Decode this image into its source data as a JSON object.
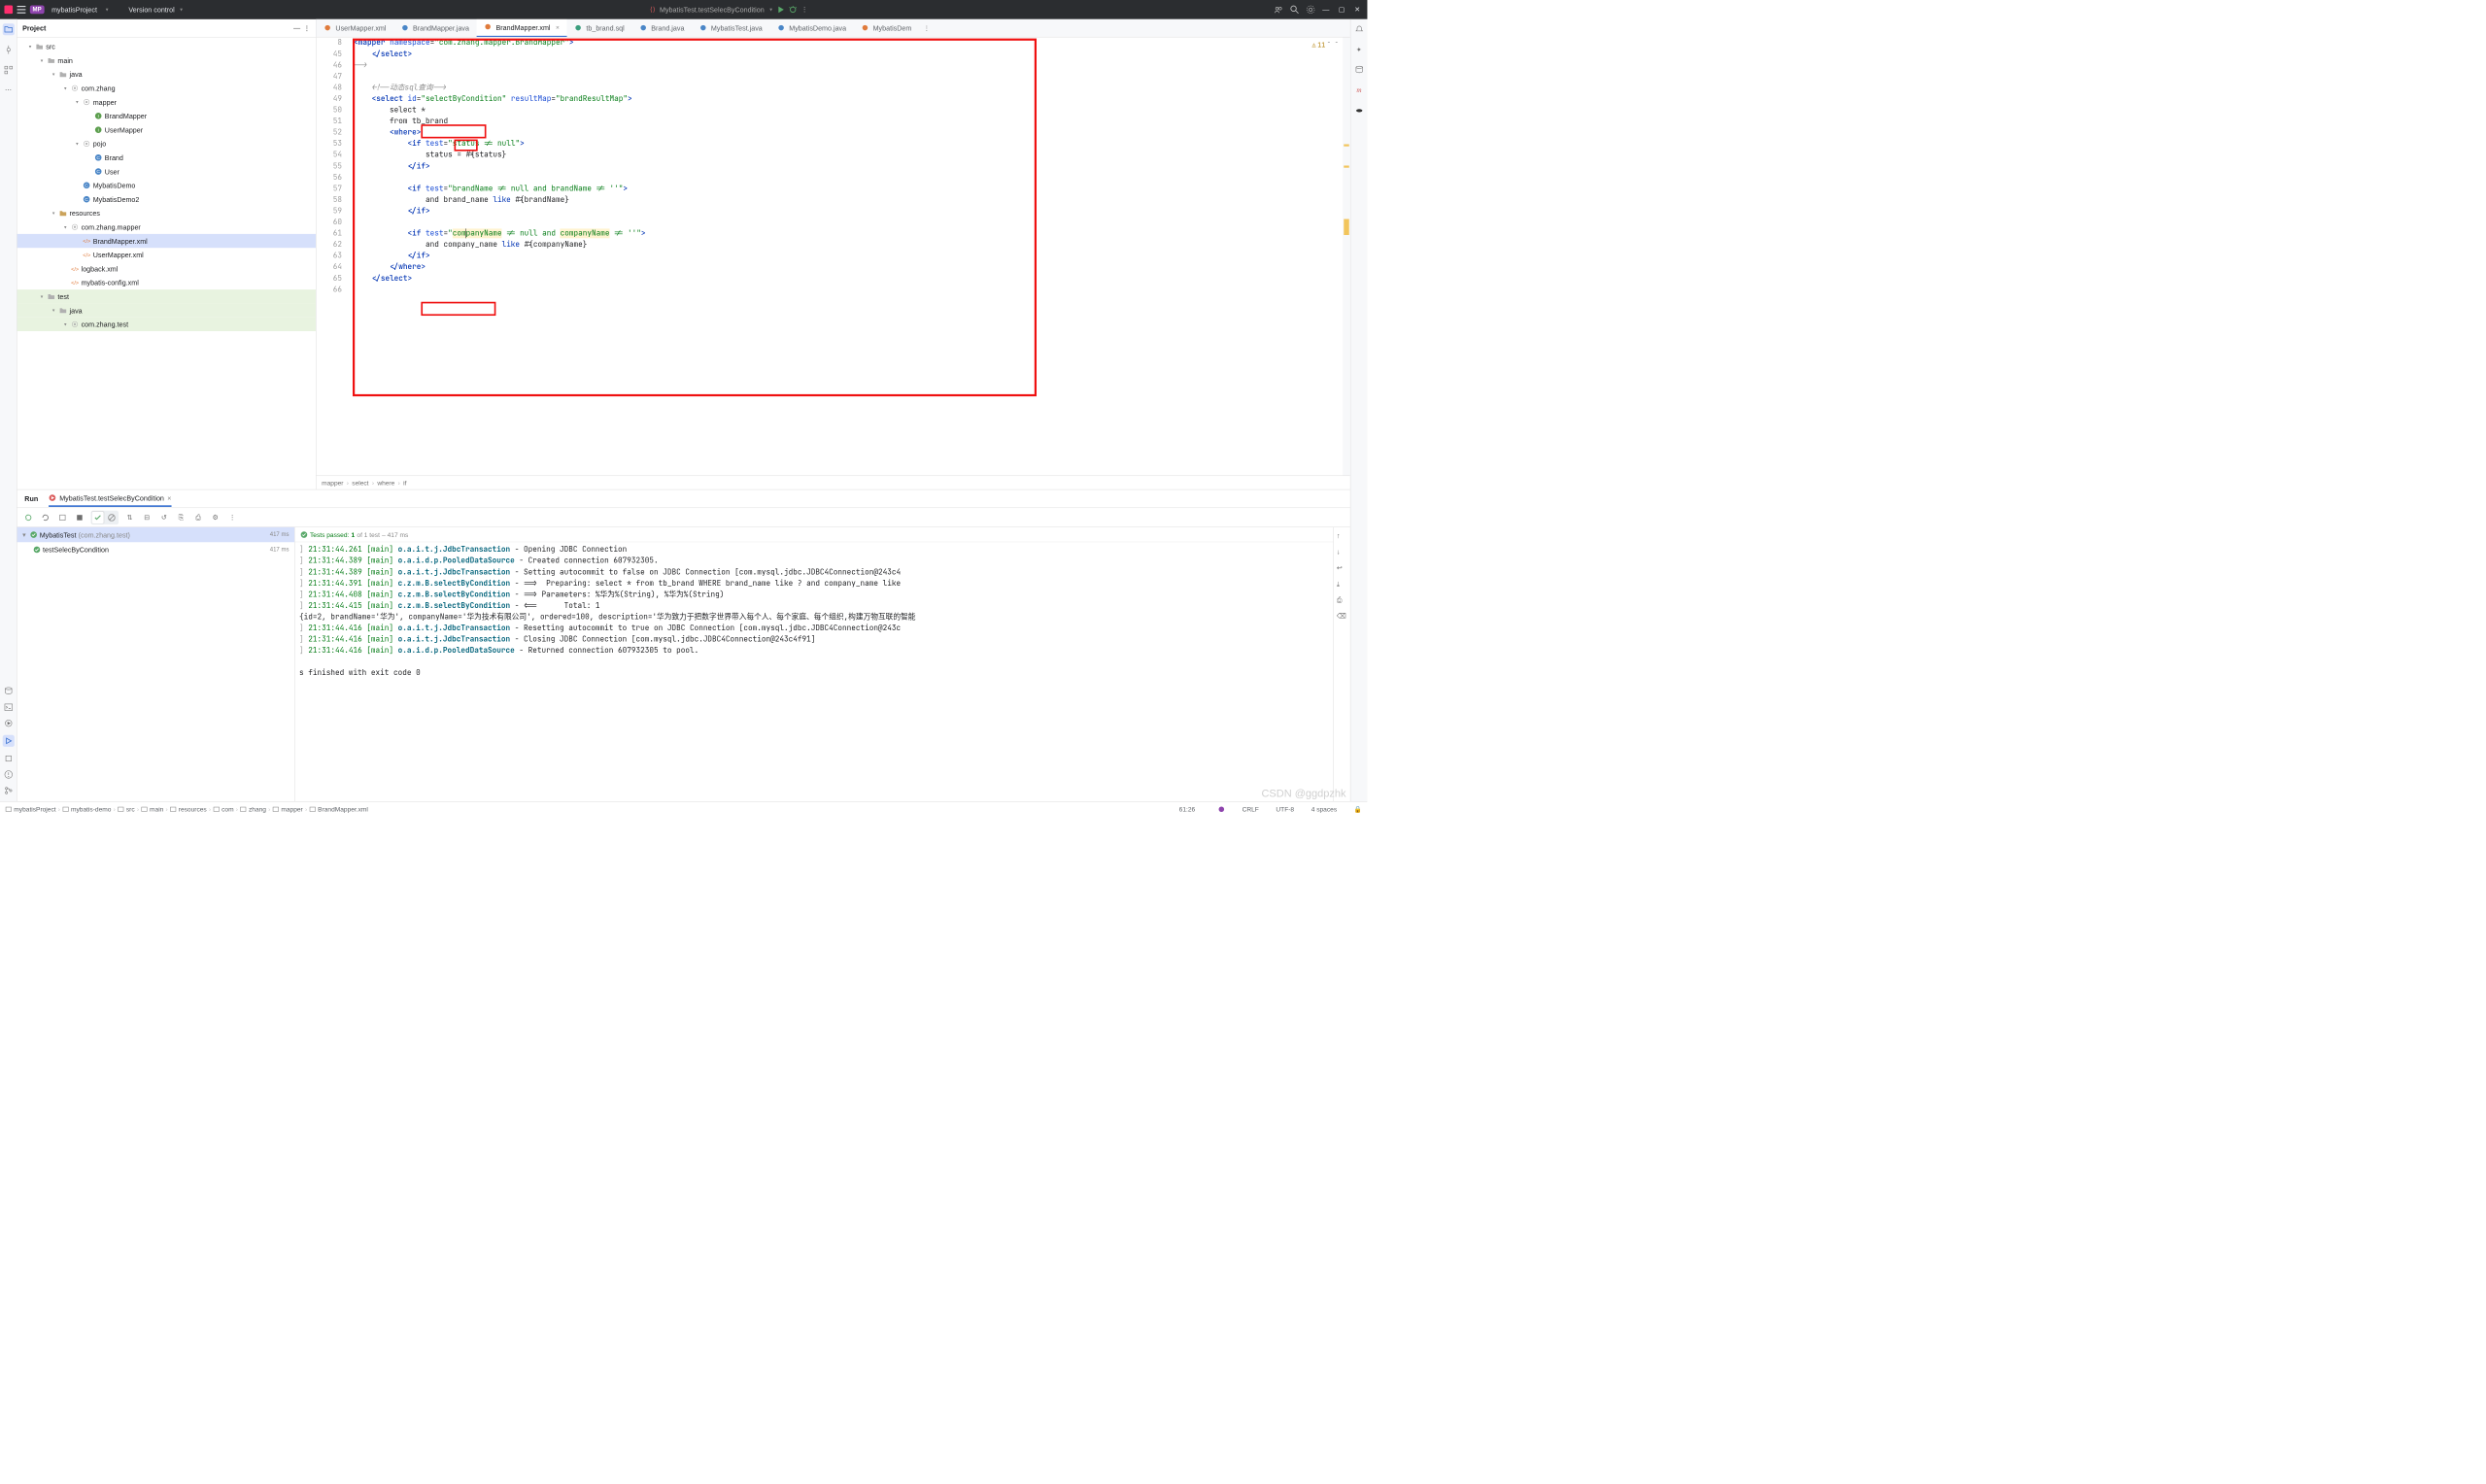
{
  "titlebar": {
    "projectBadge": "MP",
    "projectName": "mybatisProject",
    "versionControl": "Version control",
    "runConfig": "MybatisTest.testSelecByCondition"
  },
  "toolWindow": {
    "project": "Project"
  },
  "tree": {
    "src": "src",
    "main": "main",
    "java": "java",
    "comzhang": "com.zhang",
    "mapper": "mapper",
    "BrandMapper": "BrandMapper",
    "UserMapper": "UserMapper",
    "pojo": "pojo",
    "Brand": "Brand",
    "User": "User",
    "MybatisDemo": "MybatisDemo",
    "MybatisDemo2": "MybatisDemo2",
    "resources": "resources",
    "comzhangmapper": "com.zhang.mapper",
    "BrandMapperXml": "BrandMapper.xml",
    "UserMapperXml": "UserMapper.xml",
    "logback": "logback.xml",
    "mybatiscfg": "mybatis-config.xml",
    "test": "test",
    "testjava": "java",
    "comzhangtest": "com.zhang.test"
  },
  "tabs": [
    {
      "label": "UserMapper.xml",
      "active": false
    },
    {
      "label": "BrandMapper.java",
      "active": false
    },
    {
      "label": "BrandMapper.xml",
      "active": true
    },
    {
      "label": "tb_brand.sql",
      "active": false
    },
    {
      "label": "Brand.java",
      "active": false
    },
    {
      "label": "MybatisTest.java",
      "active": false
    },
    {
      "label": "MybatisDemo.java",
      "active": false
    },
    {
      "label": "MybatisDem",
      "active": false
    }
  ],
  "code": {
    "lines": [
      "8",
      "45",
      "46",
      "47",
      "48",
      "49",
      "50",
      "51",
      "52",
      "53",
      "54",
      "55",
      "56",
      "57",
      "58",
      "59",
      "60",
      "61",
      "62",
      "63",
      "64",
      "65",
      "66"
    ],
    "namespace": "com.zhang.mapper.BrandMapper",
    "cmt1": "<!--动态sql查询-->",
    "selectId": "selectByCondition",
    "resultMap": "brandResultMap",
    "selectStar": "select *",
    "from": "from tb_brand",
    "ifStatus": "status != null",
    "statusLine": "status = #{status}",
    "ifBrand": "brandName != null and brandName != ''",
    "brandLine": "and brand_name ",
    "brandLike": "like",
    "brandParam": " #{brandName}",
    "ifCompany": "companyName != null and companyName != ''",
    "companyLine": "and company_name ",
    "companyLike": "like",
    "companyParam": " #{companyName}"
  },
  "warn": {
    "count": "11"
  },
  "breadcrumbs": [
    "mapper",
    "select",
    "where",
    "if"
  ],
  "run": {
    "label": "Run",
    "config": "MybatisTest.testSelecByCondition",
    "passedPrefix": "Tests passed:",
    "passedCount": "1",
    "passedOf": "of 1 test",
    "passedTime": "– 417 ms",
    "testClass": "MybatisTest",
    "testPkg": "(com.zhang.test)",
    "testMethod": "testSelecByCondition",
    "time": "417 ms"
  },
  "log": [
    {
      "br": "] ",
      "ts": "21:31:44.261",
      "th": " [main] ",
      "cls": "o.a.i.t.j.JdbcTransaction",
      "msg": " - Opening JDBC Connection"
    },
    {
      "br": "] ",
      "ts": "21:31:44.389",
      "th": " [main] ",
      "cls": "o.a.i.d.p.PooledDataSource",
      "msg": " - Created connection 607932305."
    },
    {
      "br": "] ",
      "ts": "21:31:44.389",
      "th": " [main] ",
      "cls": "o.a.i.t.j.JdbcTransaction",
      "msg": " - Setting autocommit to false on JDBC Connection [com.mysql.jdbc.JDBC4Connection@243c4"
    },
    {
      "br": "] ",
      "ts": "21:31:44.391",
      "th": " [main] ",
      "cls": "c.z.m.B.selectByCondition",
      "msg": " - ==>  Preparing: select * from tb_brand WHERE brand_name like ? and company_name like"
    },
    {
      "br": "] ",
      "ts": "21:31:44.408",
      "th": " [main] ",
      "cls": "c.z.m.B.selectByCondition",
      "msg": " - ==> Parameters: %华为%(String), %华为%(String)"
    },
    {
      "br": "] ",
      "ts": "21:31:44.415",
      "th": " [main] ",
      "cls": "c.z.m.B.selectByCondition",
      "msg": " - <==      Total: 1"
    },
    {
      "plain": "{id=2, brandName='华为', companyName='华为技术有限公司', ordered=100, description='华为致力于把数字世界带入每个人、每个家庭、每个组织,构建万物互联的智能"
    },
    {
      "br": "] ",
      "ts": "21:31:44.416",
      "th": " [main] ",
      "cls": "o.a.i.t.j.JdbcTransaction",
      "msg": " - Resetting autocommit to true on JDBC Connection [com.mysql.jdbc.JDBC4Connection@243c"
    },
    {
      "br": "] ",
      "ts": "21:31:44.416",
      "th": " [main] ",
      "cls": "o.a.i.t.j.JdbcTransaction",
      "msg": " - Closing JDBC Connection [com.mysql.jdbc.JDBC4Connection@243c4f91]"
    },
    {
      "br": "] ",
      "ts": "21:31:44.416",
      "th": " [main] ",
      "cls": "o.a.i.d.p.PooledDataSource",
      "msg": " - Returned connection 607932305 to pool."
    }
  ],
  "exit": "s finished with exit code 0",
  "status": {
    "crumbs": [
      "mybatisProject",
      "mybatis-demo",
      "src",
      "main",
      "resources",
      "com",
      "zhang",
      "mapper",
      "BrandMapper.xml"
    ],
    "pos": "61:26",
    "eol": "CRLF",
    "enc": "UTF-8",
    "indent": "4 spaces"
  },
  "watermark": "CSDN @ggdpzhk"
}
